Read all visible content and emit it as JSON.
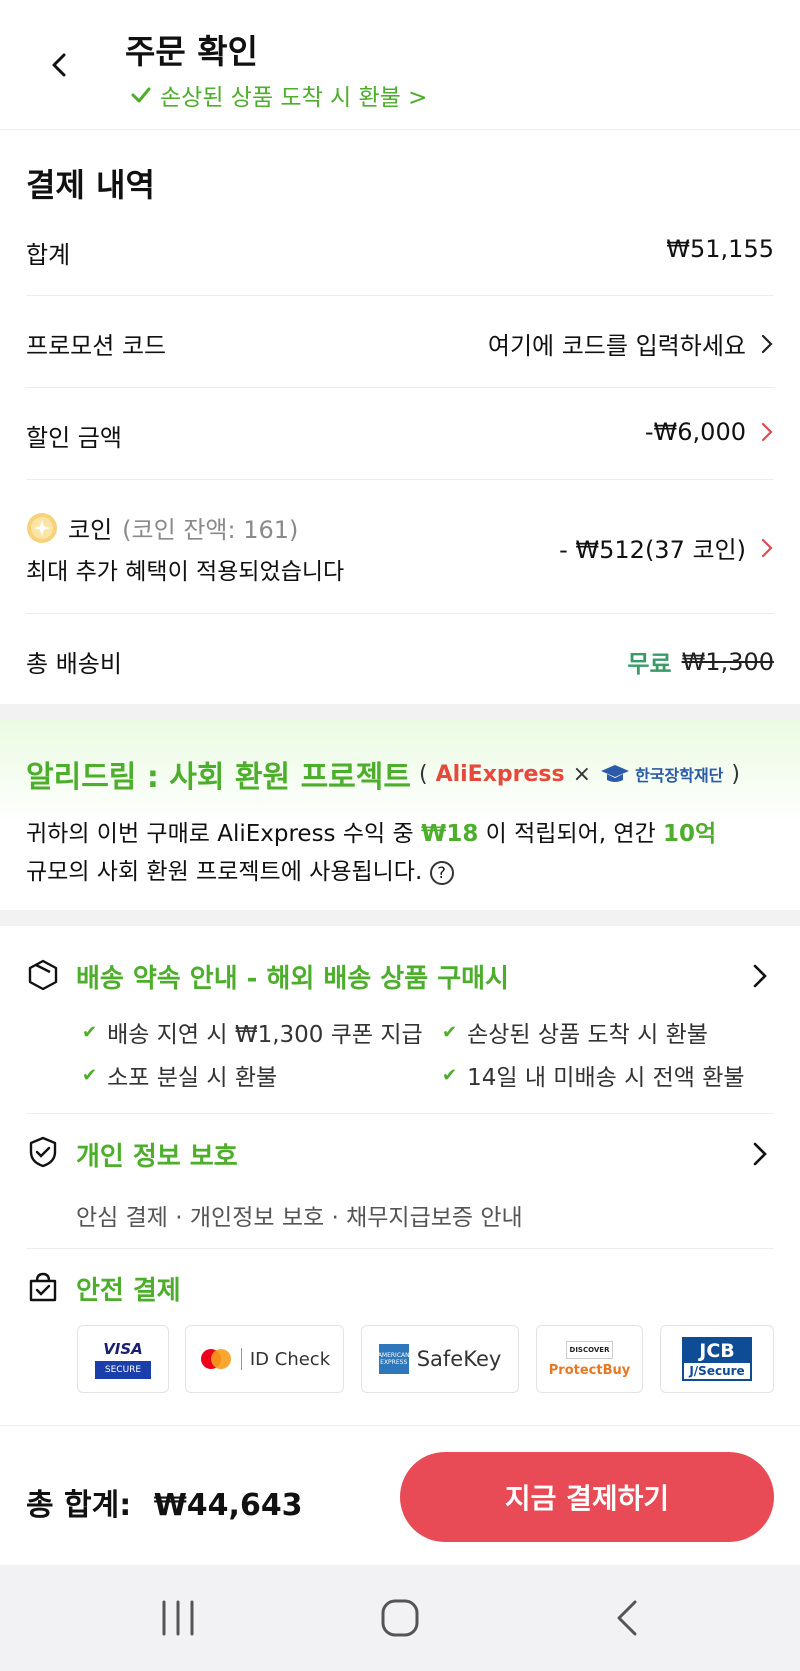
{
  "header": {
    "title": "주문 확인",
    "subtitle": "손상된 상품 도착 시 환불 >"
  },
  "payment": {
    "title": "결제 내역",
    "subtotal_label": "합계",
    "subtotal_value": "₩51,155",
    "promo_label": "프로모션 코드",
    "promo_placeholder": "여기에 코드를 입력하세요",
    "discount_label": "할인 금액",
    "discount_value": "-₩6,000",
    "coin_label": "코인",
    "coin_balance": "(코인 잔액: 161)",
    "coin_notice": "최대 추가 혜택이 적용되었습니다",
    "coin_value": "- ₩512(37 코인)",
    "shipping_label": "총 배송비",
    "shipping_free": "무료",
    "shipping_original": "₩1,300"
  },
  "promo": {
    "title": "알리드림 : 사회 환원 프로젝트",
    "paren_open": "(",
    "paren_close": ")",
    "brand_ae": "AliExpress",
    "times": "×",
    "brand_kf": "한국장학재단",
    "text_1": "귀하의 이번 구매로 AliExpress 수익 중 ",
    "amount": "₩18",
    "text_2": " 이 적립되어, 연간 ",
    "annual": "10억",
    "text_3": "규모의 사회 환원 프로젝트에 사용됩니다."
  },
  "delivery": {
    "title": "배송 약속 안내 - 해외 배송 상품 구매시",
    "items": [
      "배송 지연 시 ₩1,300 쿠폰 지급",
      "손상된 상품 도착 시 환불",
      "소포 분실 시 환불",
      "14일 내 미배송 시 전액 환불"
    ]
  },
  "privacy": {
    "title": "개인 정보 보호",
    "subtitle": "안심 결제 · 개인정보 보호 · 채무지급보증 안내"
  },
  "secure": {
    "title": "안전 결제",
    "cards": {
      "visa": "VISA",
      "visa_sub": "SECURE",
      "mc": "ID Check",
      "amex": "SafeKey",
      "amex_badge": "AMERICAN EXPRESS",
      "discover": "DISCOVER",
      "discover_sub": "ProtectBuy",
      "jcb": "JCB",
      "jcb_sub": "J/Secure"
    }
  },
  "footer": {
    "total_label": "총 합계:",
    "total_value": "₩44,643",
    "pay_button": "지금 결제하기"
  },
  "colors": {
    "accent_green": "#4cae2b",
    "accent_red": "#e04a55",
    "button_red": "#e84b56"
  }
}
